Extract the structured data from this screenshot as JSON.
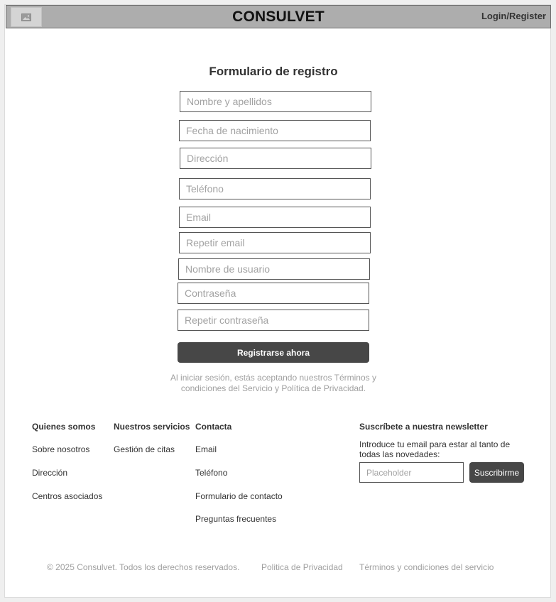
{
  "header": {
    "logo_icon": "image-icon",
    "brand": "CONSULVET",
    "login_label": "Login/Register"
  },
  "form": {
    "title": "Formulario de registro",
    "fields": [
      {
        "placeholder": "Nombre y apellidos"
      },
      {
        "placeholder": "Fecha de nacimiento"
      },
      {
        "placeholder": "Dirección"
      },
      {
        "placeholder": "Teléfono"
      },
      {
        "placeholder": "Email"
      },
      {
        "placeholder": "Repetir email"
      },
      {
        "placeholder": "Nombre de usuario"
      },
      {
        "placeholder": "Contraseña"
      },
      {
        "placeholder": "Repetir contraseña"
      }
    ],
    "submit_label": "Registrarse ahora",
    "legal_note": "Al iniciar sesión, estás aceptando nuestros Términos y condiciones del Servicio y Política de Privacidad."
  },
  "footer": {
    "about": {
      "heading": "Quienes somos",
      "links": [
        "Sobre nosotros",
        "Dirección",
        "Centros asociados"
      ]
    },
    "services": {
      "heading": "Nuestros servicios",
      "links": [
        "Gestión de citas"
      ]
    },
    "contact": {
      "heading": "Contacta",
      "links": [
        "Email",
        "Teléfono",
        "Formulario de contacto",
        "Preguntas frecuentes"
      ]
    },
    "newsletter": {
      "heading": "Suscríbete a nuestra newsletter",
      "text": "Introduce tu email para estar al tanto de todas las novedades:",
      "input_placeholder": "Placeholder",
      "button_label": "Suscribirme"
    },
    "bottom": {
      "copyright": "© 2025 Consulvet. Todos los derechos reservados.",
      "privacy": "Politica de Privacidad",
      "terms": "Términos y condiciones del servicio"
    }
  },
  "colors": {
    "header_bg": "#adadad",
    "button_bg": "#474747",
    "muted_text": "#a0a0a0"
  }
}
